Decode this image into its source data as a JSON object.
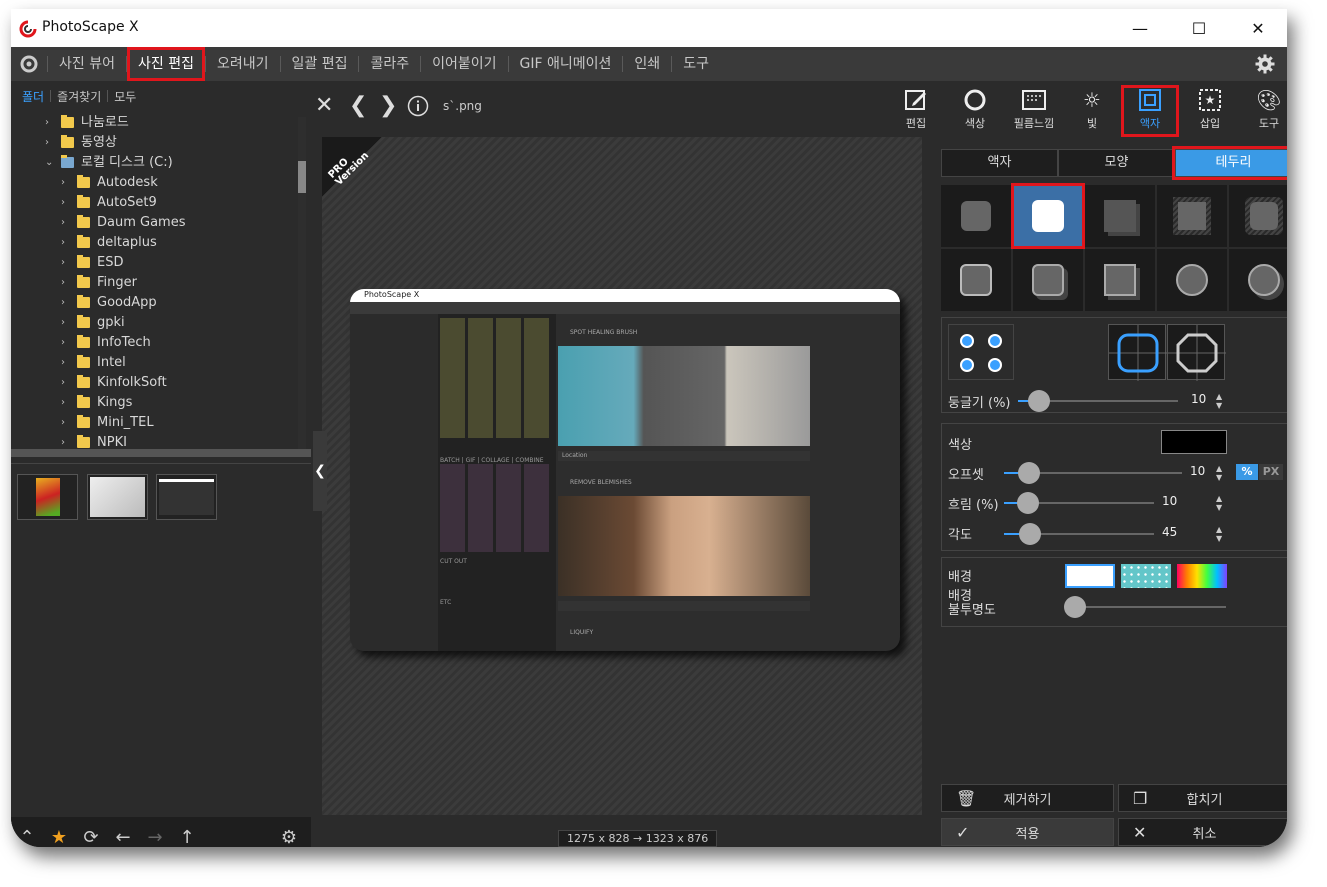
{
  "app": {
    "title": "PhotoScape X"
  },
  "window_controls": {
    "minimize": "—",
    "maximize": "☐",
    "close": "✕"
  },
  "menu": {
    "items": [
      "사진 뷰어",
      "사진 편집",
      "오려내기",
      "일괄 편집",
      "콜라주",
      "이어붙이기",
      "GIF 애니메이션",
      "인쇄",
      "도구"
    ],
    "active": "사진 편집"
  },
  "left_panel": {
    "tabs": [
      "폴더",
      "즐겨찾기",
      "모두"
    ],
    "tree": [
      {
        "label": "나눔로드",
        "level": 1
      },
      {
        "label": "동영상",
        "level": 1
      },
      {
        "label": "로컬 디스크 (C:)",
        "level": 1
      },
      {
        "label": "Autodesk",
        "level": 2
      },
      {
        "label": "AutoSet9",
        "level": 2
      },
      {
        "label": "Daum Games",
        "level": 2
      },
      {
        "label": "deltaplus",
        "level": 2
      },
      {
        "label": "ESD",
        "level": 2
      },
      {
        "label": "Finger",
        "level": 2
      },
      {
        "label": "GoodApp",
        "level": 2
      },
      {
        "label": "gpki",
        "level": 2
      },
      {
        "label": "InfoTech",
        "level": 2
      },
      {
        "label": "Intel",
        "level": 2
      },
      {
        "label": "KinfolkSoft",
        "level": 2
      },
      {
        "label": "Kings",
        "level": 2
      },
      {
        "label": "Mini_TEL",
        "level": 2
      },
      {
        "label": "NPKI",
        "level": 2
      }
    ]
  },
  "center": {
    "file_name": "s`.png",
    "pro_badge": "PRO Version",
    "size_label": "1275 x 828 → 1323 x 876",
    "preview": {
      "title": "PhotoScape X",
      "sections": [
        "SPOT HEALING BRUSH",
        "REMOVE BLEMISHES",
        "LIQUIFY"
      ],
      "footer": "Location",
      "groups": [
        "BATCH | GIF | COLLAGE | COMBINE",
        "CUT OUT",
        "ETC"
      ]
    }
  },
  "right_panel": {
    "tools": [
      {
        "label": "편집",
        "icon": "edit-icon"
      },
      {
        "label": "색상",
        "icon": "color-icon"
      },
      {
        "label": "필름느낌",
        "icon": "film-icon"
      },
      {
        "label": "빛",
        "icon": "light-icon"
      },
      {
        "label": "액자",
        "icon": "frame-icon"
      },
      {
        "label": "삽입",
        "icon": "insert-icon"
      },
      {
        "label": "도구",
        "icon": "tools-icon"
      }
    ],
    "active_tool": "액자",
    "subtabs": [
      "액자",
      "모양",
      "테두리"
    ],
    "active_subtab": "테두리",
    "roundness": {
      "label": "둥글기 (%)",
      "value": "10",
      "fraction": 0.1
    },
    "shadow": {
      "color_label": "색상",
      "color": "#000000",
      "offset": {
        "label": "오프셋",
        "value": "10",
        "fraction": 0.1
      },
      "unit_percent": "%",
      "unit_px": "PX",
      "blur": {
        "label": "흐림 (%)",
        "value": "10",
        "fraction": 0.1
      },
      "angle": {
        "label": "각도",
        "value": "45",
        "fraction": 0.12
      }
    },
    "background": {
      "label": "배경",
      "opacity_label": "배경\n불투명도"
    },
    "buttons": {
      "remove": "제거하기",
      "merge": "합치기",
      "apply": "적용",
      "cancel": "취소"
    }
  },
  "colors": {
    "accent": "#3aa0ff",
    "highlight": "#e0161c",
    "panel": "#2b2b2b"
  }
}
